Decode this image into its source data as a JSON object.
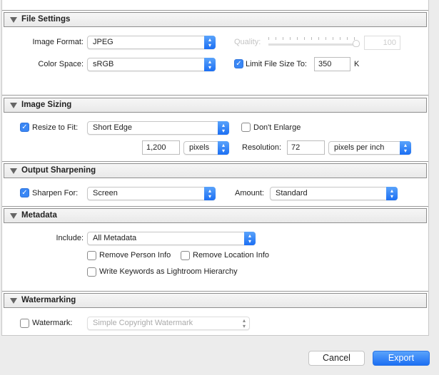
{
  "file_settings": {
    "title": "File Settings",
    "image_format_label": "Image Format:",
    "image_format": "JPEG",
    "quality_label": "Quality:",
    "quality": "100",
    "quality_slider_percent": 100,
    "color_space_label": "Color Space:",
    "color_space": "sRGB",
    "limit_checked": true,
    "limit_label": "Limit File Size To:",
    "limit_value": "350",
    "limit_unit": "K"
  },
  "image_sizing": {
    "title": "Image Sizing",
    "resize_checked": true,
    "resize_label": "Resize to Fit:",
    "resize_mode": "Short Edge",
    "dont_enlarge_checked": false,
    "dont_enlarge_label": "Don't Enlarge",
    "size_value": "1,200",
    "size_unit": "pixels",
    "resolution_label": "Resolution:",
    "resolution_value": "72",
    "resolution_unit": "pixels per inch"
  },
  "output_sharpening": {
    "title": "Output Sharpening",
    "sharpen_checked": true,
    "sharpen_label": "Sharpen For:",
    "sharpen_for": "Screen",
    "amount_label": "Amount:",
    "amount": "Standard"
  },
  "metadata": {
    "title": "Metadata",
    "include_label": "Include:",
    "include": "All Metadata",
    "remove_person_label": "Remove Person Info",
    "remove_location_label": "Remove Location Info",
    "write_keywords_label": "Write Keywords as Lightroom Hierarchy"
  },
  "watermarking": {
    "title": "Watermarking",
    "watermark_checked": false,
    "watermark_label": "Watermark:",
    "watermark": "Simple Copyright Watermark"
  },
  "footer": {
    "cancel": "Cancel",
    "export": "Export"
  },
  "colors": {
    "accent": "#1c6ff3"
  }
}
